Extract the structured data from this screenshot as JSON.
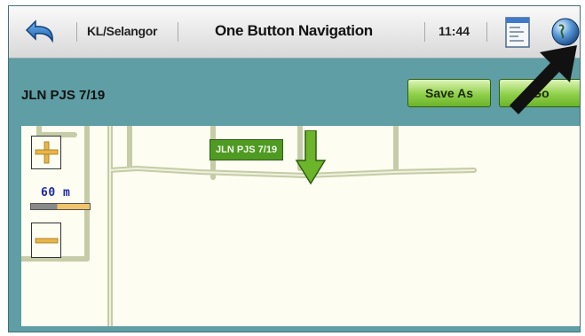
{
  "header": {
    "region": "KL/Selangor",
    "title": "One Button Navigation",
    "time": "11:44",
    "back_icon": "back-arrow-icon",
    "document_icon": "document-icon",
    "globe_icon": "globe-icon"
  },
  "address_bar": {
    "address": "JLN PJS 7/19",
    "save_as_label": "Save As",
    "go_label": "Go"
  },
  "map": {
    "street_label": "JLN PJS 7/19",
    "scale": "60 m",
    "zoom_in_icon": "plus-icon",
    "zoom_out_icon": "minus-icon",
    "pin_icon": "down-arrow-pin-icon"
  },
  "colors": {
    "frame": "#5e9ea4",
    "map_bg": "#fdfdf1",
    "road": "#d6ddb8",
    "button_green": "#8fcf4a",
    "pin_green": "#4f9a23"
  }
}
